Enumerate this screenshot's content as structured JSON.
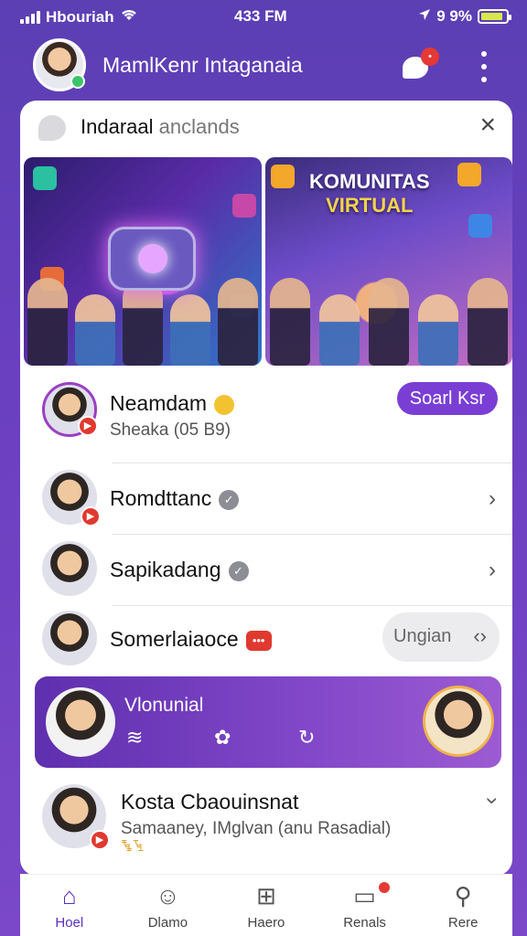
{
  "status_bar": {
    "carrier": "Hbouriah",
    "time": "433 FM",
    "battery_text": "9 9%",
    "battery_level": 0.9
  },
  "header": {
    "title": "MamlKenr Intaganaia",
    "chat_badge": "•",
    "colors": {
      "background": "#6a3fc0",
      "accent": "#7a3ed4"
    }
  },
  "card": {
    "title_main": "Indaraal",
    "title_dim": "anclands",
    "banner_right_title_1": "KOMUNITAS",
    "banner_right_title_2": "VIRTUAL"
  },
  "list": {
    "item1": {
      "name": "Neamdam",
      "sub": "Sheaka (05 B9)",
      "button": "Soarl Ksr"
    },
    "item2": {
      "name": "Romdttanc"
    },
    "item3": {
      "name": "Sapikadang"
    },
    "item4": {
      "name": "Somerlaiaoce",
      "button": "Ungian"
    }
  },
  "promo": {
    "title": "Vlonunial"
  },
  "item5": {
    "name": "Kosta Cbaouinsnat",
    "sub": "Samaaney, IMglvan (anu Rasadial)",
    "extra": "ꔄꔃ"
  },
  "nav": [
    {
      "label": "Hoel",
      "icon": "home-icon",
      "active": true
    },
    {
      "label": "Dlamo",
      "icon": "smile-icon",
      "active": false
    },
    {
      "label": "Haero",
      "icon": "grid-icon",
      "active": false
    },
    {
      "label": "Renals",
      "icon": "chat-icon",
      "active": false
    },
    {
      "label": "Rere",
      "icon": "person-icon",
      "active": false
    }
  ]
}
